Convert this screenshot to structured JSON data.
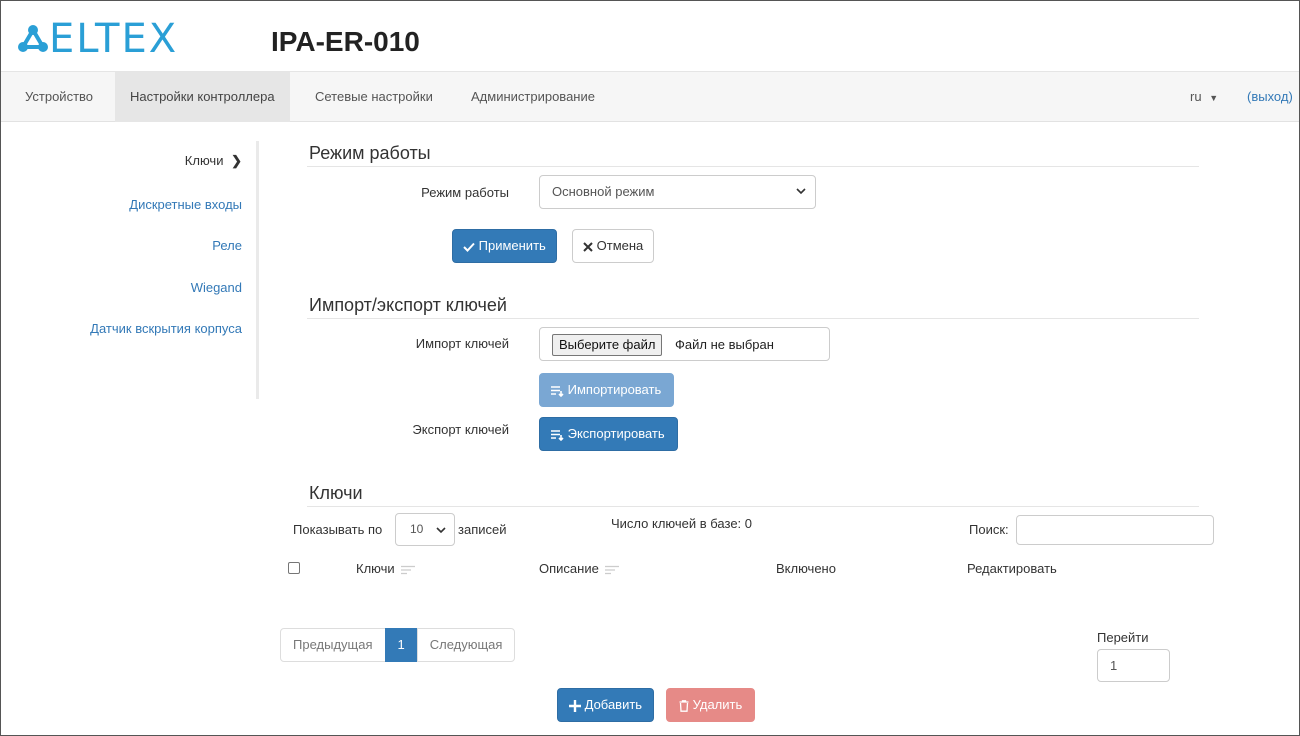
{
  "header": {
    "logo_text": "ELTEX",
    "device_name": "IPA-ER-010"
  },
  "navbar": {
    "items": [
      {
        "label": "Устройство"
      },
      {
        "label": "Настройки контроллера"
      },
      {
        "label": "Сетевые настройки"
      },
      {
        "label": "Администрирование"
      }
    ],
    "language": "ru",
    "logout": "(выход)"
  },
  "sidebar": {
    "items": [
      {
        "label": "Ключи"
      },
      {
        "label": "Дискретные входы"
      },
      {
        "label": "Реле"
      },
      {
        "label": "Wiegand"
      },
      {
        "label": "Датчик вскрытия корпуса"
      }
    ]
  },
  "mode_section": {
    "title": "Режим работы",
    "field_label": "Режим работы",
    "selected": "Основной режим",
    "apply": "Применить",
    "cancel": "Отмена"
  },
  "import_export": {
    "title": "Импорт/экспорт ключей",
    "import_label": "Импорт ключей",
    "file_button": "Выберите файл",
    "file_status": "Файл не выбран",
    "import_button": "Импортировать",
    "export_label": "Экспорт ключей",
    "export_button": "Экспортировать"
  },
  "keys": {
    "title": "Ключи",
    "show_prefix": "Показывать по",
    "page_size": "10",
    "show_suffix": "записей",
    "count_text": "Число ключей в базе: 0",
    "search_label": "Поиск:",
    "search_value": "",
    "columns": [
      "Ключи",
      "Описание",
      "Включено",
      "Редактировать"
    ],
    "pagination": {
      "prev": "Предыдущая",
      "current": "1",
      "next": "Следующая"
    },
    "goto_label": "Перейти",
    "goto_value": "1",
    "add_button": "Добавить",
    "delete_button": "Удалить"
  },
  "colors": {
    "primary": "#337ab7",
    "logo": "#2a9fd6",
    "link": "#3379b7",
    "danger_disabled": "#e68a87"
  }
}
